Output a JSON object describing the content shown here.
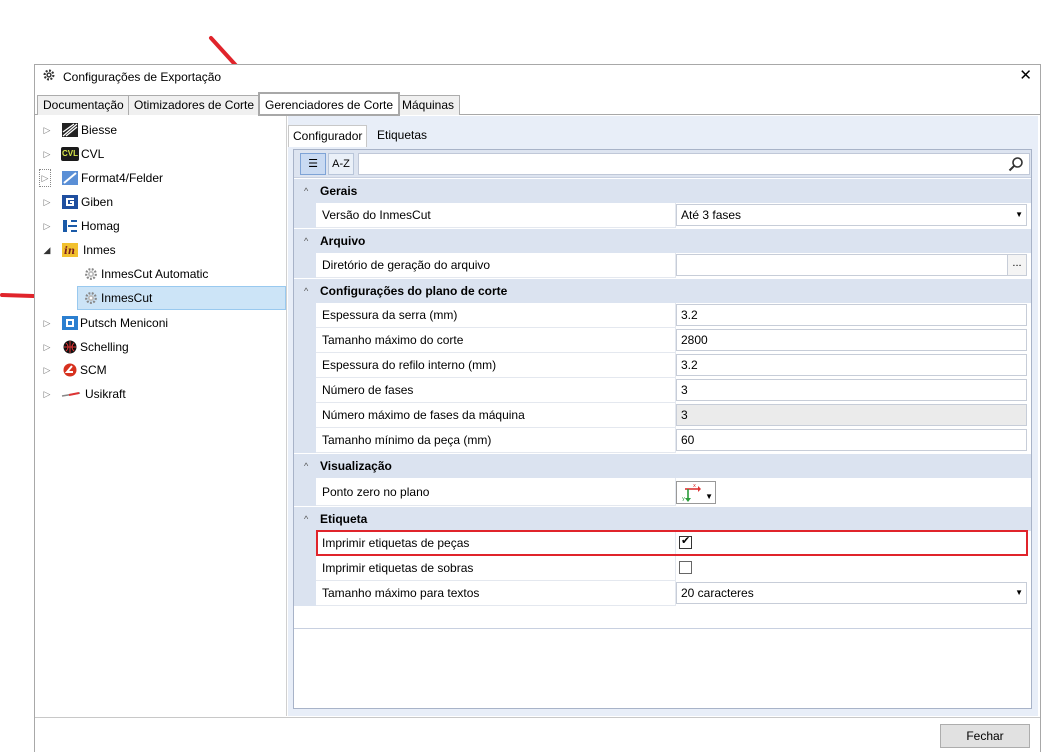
{
  "window": {
    "title": "Configurações de Exportação",
    "close_glyph": "✕"
  },
  "top_tabs": [
    {
      "label": "Documentação"
    },
    {
      "label": "Otimizadores de Corte"
    },
    {
      "label": "Gerenciadores de Corte",
      "active": true
    },
    {
      "label": "Máquinas"
    }
  ],
  "tree": {
    "items": [
      {
        "label": "Biesse",
        "icon": "biesse-logo"
      },
      {
        "label": "CVL",
        "icon": "cvl-logo"
      },
      {
        "label": "Format4/Felder",
        "icon": "format4-logo"
      },
      {
        "label": "Giben",
        "icon": "giben-logo"
      },
      {
        "label": "Homag",
        "icon": "homag-logo"
      },
      {
        "label": "Inmes",
        "icon": "inmes-logo",
        "expanded": true
      },
      {
        "label": "InmesCut Automatic",
        "icon": "gear-icon"
      },
      {
        "label": "InmesCut",
        "icon": "gear-icon",
        "selected": true
      },
      {
        "label": "Putsch Meniconi",
        "icon": "putsch-logo"
      },
      {
        "label": "Schelling",
        "icon": "schelling-logo"
      },
      {
        "label": "SCM",
        "icon": "scm-logo"
      },
      {
        "label": "Usikraft",
        "icon": "usikraft-logo"
      }
    ],
    "cvl_badge": "CVL"
  },
  "sub_tabs": [
    {
      "label": "Configurador",
      "active": true
    },
    {
      "label": "Etiquetas"
    }
  ],
  "toolbar": {
    "categorized_glyph": "☰",
    "alpha_label": "A-Z"
  },
  "grid": {
    "cat_gerais": "Gerais",
    "versao_label": "Versão do InmesCut",
    "versao_value": "Até 3 fases",
    "cat_arquivo": "Arquivo",
    "diretorio_label": "Diretório de geração do arquivo",
    "diretorio_value": "",
    "ellipsis": "...",
    "cat_plano": "Configurações do plano de corte",
    "espessura_serra_label": "Espessura da serra (mm)",
    "espessura_serra_value": "3.2",
    "tam_max_corte_label": "Tamanho máximo do corte",
    "tam_max_corte_value": "2800",
    "espessura_refilo_label": "Espessura do refilo interno (mm)",
    "espessura_refilo_value": "3.2",
    "num_fases_label": "Número de fases",
    "num_fases_value": "3",
    "num_max_fases_label": "Número máximo de fases da máquina",
    "num_max_fases_value": "3",
    "tam_min_peca_label": "Tamanho mínimo da peça (mm)",
    "tam_min_peca_value": "60",
    "cat_visualizacao": "Visualização",
    "ponto_zero_label": "Ponto zero no plano",
    "ponto_zero_icon": "axis-origin-icon",
    "cat_etiqueta": "Etiqueta",
    "imprimir_pecas_label": "Imprimir etiquetas de peças",
    "imprimir_pecas_checked": true,
    "imprimir_sobras_label": "Imprimir etiquetas de sobras",
    "imprimir_sobras_checked": false,
    "tam_max_textos_label": "Tamanho máximo para textos",
    "tam_max_textos_value": "20 caracteres",
    "check_glyph": "✔",
    "dropdown_glyph": "▼"
  },
  "buttons": {
    "close_label": "Fechar"
  },
  "colors": {
    "highlight": "#e0242b",
    "selection": "#cce4f7",
    "category_band": "#dbe3f0"
  }
}
